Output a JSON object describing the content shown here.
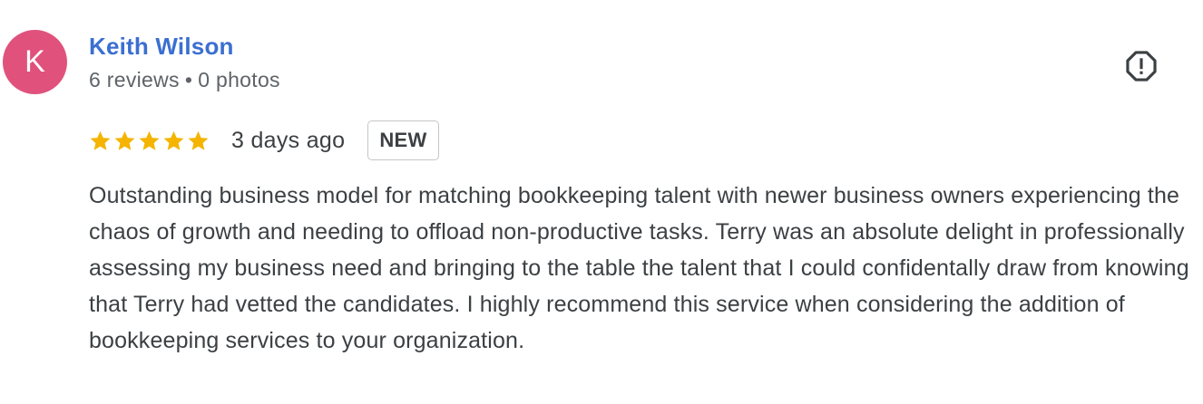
{
  "reviewer": {
    "avatar_initial": "K",
    "avatar_color": "#e0527c",
    "name": "Keith Wilson",
    "name_color": "#3b6fd1",
    "reviews_count": "6 reviews",
    "separator": "•",
    "photos_count": "0 photos"
  },
  "report": {
    "icon": "report-flag-icon"
  },
  "rating": {
    "stars": 5,
    "max": 5,
    "star_color": "#f4b400",
    "icon": "star-icon"
  },
  "time_ago": "3 days ago",
  "badge": "NEW",
  "review_text": "Outstanding business model for matching bookkeeping talent with newer business owners experiencing the chaos of growth and needing to offload non-productive tasks. Terry was an absolute delight in professionally assessing my business need and bringing to the table the talent that I could confidentally draw from knowing that Terry had vetted the candidates. I highly recommend this service when considering the addition of bookkeeping services to your organization."
}
